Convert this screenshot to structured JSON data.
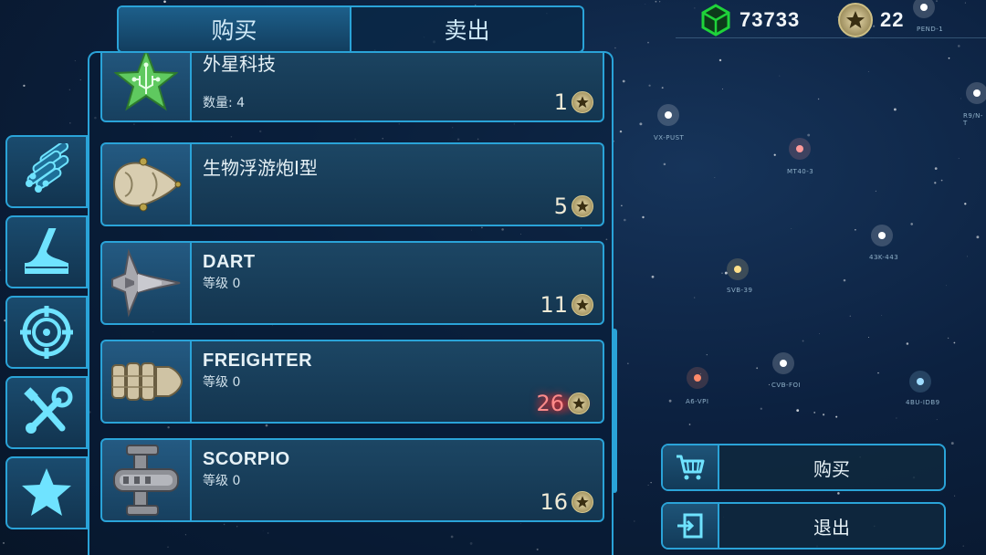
{
  "tabs": [
    {
      "label": "购买",
      "active": true
    },
    {
      "label": "卖出",
      "active": false
    }
  ],
  "currency": {
    "crystals": "73733",
    "stars": "22"
  },
  "items": [
    {
      "name": "外星科技",
      "sub": "数量: 4",
      "price": "1",
      "highlight": false,
      "icon": "alien-tech-icon"
    },
    {
      "name": "生物浮游炮I型",
      "sub": "",
      "price": "5",
      "highlight": false,
      "icon": "bio-turret-icon"
    },
    {
      "name": "DART",
      "sub": "等级 0",
      "price": "11",
      "highlight": false,
      "icon": "dart-ship-icon"
    },
    {
      "name": "FREIGHTER",
      "sub": "等级 0",
      "price": "26",
      "highlight": true,
      "icon": "freighter-ship-icon"
    },
    {
      "name": "SCORPIO",
      "sub": "等级 0",
      "price": "16",
      "highlight": false,
      "icon": "scorpio-ship-icon"
    }
  ],
  "sidenav": [
    "resources-icon",
    "boot-icon",
    "crosshair-icon",
    "tools-icon",
    "star-icon"
  ],
  "actions": {
    "buy_label": "购买",
    "exit_label": "退出"
  },
  "star_labels": [
    "VX-PUST",
    "MT40-3",
    "43K-443",
    "SVB-39",
    "CVB-FOI",
    "A6-VPI",
    "4BU-IDB9",
    "R9/N-T",
    "PEND-1"
  ],
  "colors": {
    "accent": "#2aa3d8",
    "crystal": "#1fd33a",
    "highlight": "#ff2a2a"
  }
}
